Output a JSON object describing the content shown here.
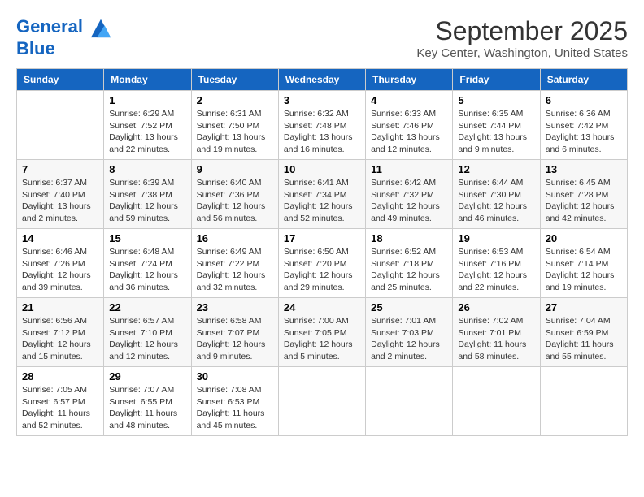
{
  "logo": {
    "line1": "General",
    "line2": "Blue"
  },
  "title": "September 2025",
  "subtitle": "Key Center, Washington, United States",
  "days_of_week": [
    "Sunday",
    "Monday",
    "Tuesday",
    "Wednesday",
    "Thursday",
    "Friday",
    "Saturday"
  ],
  "weeks": [
    [
      {
        "day": "",
        "info": ""
      },
      {
        "day": "1",
        "info": "Sunrise: 6:29 AM\nSunset: 7:52 PM\nDaylight: 13 hours\nand 22 minutes."
      },
      {
        "day": "2",
        "info": "Sunrise: 6:31 AM\nSunset: 7:50 PM\nDaylight: 13 hours\nand 19 minutes."
      },
      {
        "day": "3",
        "info": "Sunrise: 6:32 AM\nSunset: 7:48 PM\nDaylight: 13 hours\nand 16 minutes."
      },
      {
        "day": "4",
        "info": "Sunrise: 6:33 AM\nSunset: 7:46 PM\nDaylight: 13 hours\nand 12 minutes."
      },
      {
        "day": "5",
        "info": "Sunrise: 6:35 AM\nSunset: 7:44 PM\nDaylight: 13 hours\nand 9 minutes."
      },
      {
        "day": "6",
        "info": "Sunrise: 6:36 AM\nSunset: 7:42 PM\nDaylight: 13 hours\nand 6 minutes."
      }
    ],
    [
      {
        "day": "7",
        "info": "Sunrise: 6:37 AM\nSunset: 7:40 PM\nDaylight: 13 hours\nand 2 minutes."
      },
      {
        "day": "8",
        "info": "Sunrise: 6:39 AM\nSunset: 7:38 PM\nDaylight: 12 hours\nand 59 minutes."
      },
      {
        "day": "9",
        "info": "Sunrise: 6:40 AM\nSunset: 7:36 PM\nDaylight: 12 hours\nand 56 minutes."
      },
      {
        "day": "10",
        "info": "Sunrise: 6:41 AM\nSunset: 7:34 PM\nDaylight: 12 hours\nand 52 minutes."
      },
      {
        "day": "11",
        "info": "Sunrise: 6:42 AM\nSunset: 7:32 PM\nDaylight: 12 hours\nand 49 minutes."
      },
      {
        "day": "12",
        "info": "Sunrise: 6:44 AM\nSunset: 7:30 PM\nDaylight: 12 hours\nand 46 minutes."
      },
      {
        "day": "13",
        "info": "Sunrise: 6:45 AM\nSunset: 7:28 PM\nDaylight: 12 hours\nand 42 minutes."
      }
    ],
    [
      {
        "day": "14",
        "info": "Sunrise: 6:46 AM\nSunset: 7:26 PM\nDaylight: 12 hours\nand 39 minutes."
      },
      {
        "day": "15",
        "info": "Sunrise: 6:48 AM\nSunset: 7:24 PM\nDaylight: 12 hours\nand 36 minutes."
      },
      {
        "day": "16",
        "info": "Sunrise: 6:49 AM\nSunset: 7:22 PM\nDaylight: 12 hours\nand 32 minutes."
      },
      {
        "day": "17",
        "info": "Sunrise: 6:50 AM\nSunset: 7:20 PM\nDaylight: 12 hours\nand 29 minutes."
      },
      {
        "day": "18",
        "info": "Sunrise: 6:52 AM\nSunset: 7:18 PM\nDaylight: 12 hours\nand 25 minutes."
      },
      {
        "day": "19",
        "info": "Sunrise: 6:53 AM\nSunset: 7:16 PM\nDaylight: 12 hours\nand 22 minutes."
      },
      {
        "day": "20",
        "info": "Sunrise: 6:54 AM\nSunset: 7:14 PM\nDaylight: 12 hours\nand 19 minutes."
      }
    ],
    [
      {
        "day": "21",
        "info": "Sunrise: 6:56 AM\nSunset: 7:12 PM\nDaylight: 12 hours\nand 15 minutes."
      },
      {
        "day": "22",
        "info": "Sunrise: 6:57 AM\nSunset: 7:10 PM\nDaylight: 12 hours\nand 12 minutes."
      },
      {
        "day": "23",
        "info": "Sunrise: 6:58 AM\nSunset: 7:07 PM\nDaylight: 12 hours\nand 9 minutes."
      },
      {
        "day": "24",
        "info": "Sunrise: 7:00 AM\nSunset: 7:05 PM\nDaylight: 12 hours\nand 5 minutes."
      },
      {
        "day": "25",
        "info": "Sunrise: 7:01 AM\nSunset: 7:03 PM\nDaylight: 12 hours\nand 2 minutes."
      },
      {
        "day": "26",
        "info": "Sunrise: 7:02 AM\nSunset: 7:01 PM\nDaylight: 11 hours\nand 58 minutes."
      },
      {
        "day": "27",
        "info": "Sunrise: 7:04 AM\nSunset: 6:59 PM\nDaylight: 11 hours\nand 55 minutes."
      }
    ],
    [
      {
        "day": "28",
        "info": "Sunrise: 7:05 AM\nSunset: 6:57 PM\nDaylight: 11 hours\nand 52 minutes."
      },
      {
        "day": "29",
        "info": "Sunrise: 7:07 AM\nSunset: 6:55 PM\nDaylight: 11 hours\nand 48 minutes."
      },
      {
        "day": "30",
        "info": "Sunrise: 7:08 AM\nSunset: 6:53 PM\nDaylight: 11 hours\nand 45 minutes."
      },
      {
        "day": "",
        "info": ""
      },
      {
        "day": "",
        "info": ""
      },
      {
        "day": "",
        "info": ""
      },
      {
        "day": "",
        "info": ""
      }
    ]
  ]
}
